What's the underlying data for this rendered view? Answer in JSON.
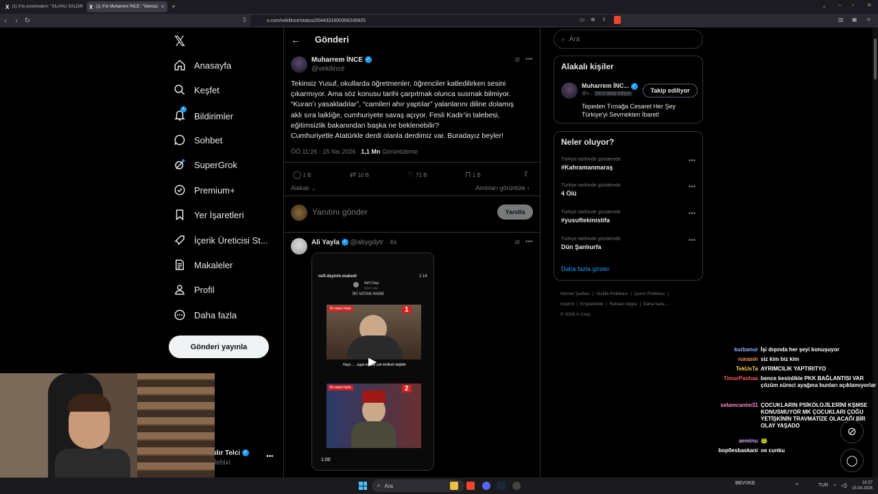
{
  "browser": {
    "tabs": [
      {
        "label": "(1) X'te postmodern: \"SİLAHLI SALDIR",
        "active": false
      },
      {
        "label": "(1) X'te Muharrem İNCE: \"Tekinsiz",
        "active": true
      }
    ],
    "url": "x.com/vekilince/status/2044331600356245825"
  },
  "sidebar": {
    "items": [
      {
        "label": "Anasayfa",
        "icon": "home-icon"
      },
      {
        "label": "Keşfet",
        "icon": "search-icon"
      },
      {
        "label": "Bildirimler",
        "icon": "bell-icon",
        "badge": "1"
      },
      {
        "label": "Sohbet",
        "icon": "chat-icon"
      },
      {
        "label": "SuperGrok",
        "icon": "grok-icon"
      },
      {
        "label": "Premium+",
        "icon": "verified-icon"
      },
      {
        "label": "Yer İşaretleri",
        "icon": "bookmark-icon"
      },
      {
        "label": "İçerik Üreticisi St...",
        "icon": "rocket-icon"
      },
      {
        "label": "Makaleler",
        "icon": "article-icon"
      },
      {
        "label": "Profil",
        "icon": "person-icon"
      },
      {
        "label": "Daha fazla",
        "icon": "more-circle-icon"
      }
    ],
    "post_button": "Gönderi yayınla",
    "account_name": "ılır Telci",
    "account_handle": "lebixi"
  },
  "header": {
    "title": "Gönderi"
  },
  "post": {
    "author": "Muharrem İNCE",
    "handle": "@vekilince",
    "text": [
      "Tekinsiz Yusuf, okullarda öğretmenler, öğrenciler katledilirken sesini",
      "çıkarmıyor. Ama söz konusu tarihi çarpıtmak olunca susmak bilmiyor.",
      "“Kuran’ı yasakladılar”, “camileri ahır yaptılar” yalanlarını diline dolamış",
      "aklı sıra laikliğe, cumhuriyete savaş açıyor. Fesli Kadir’in talebesi,",
      "eğitimsizlik bakanından başka ne beklenebilir?",
      "Cumhuriyetle Atatürkle derdi olanla derdimiz var. Buradayız beyler!"
    ],
    "time": "ÖÖ 11:26 · 15 Nis 2026 ·",
    "views_count": "1,1 Mn",
    "views_label": "Görüntüleme",
    "replies": "1 B",
    "reposts": "10 B",
    "likes": "71 B",
    "bookmarks": "1 B",
    "related_label": "Alakalı",
    "quotes_label": "Alıntıları görüntüle"
  },
  "reply_box": {
    "placeholder": "Yanıtını gönder",
    "button": "Yanıtla"
  },
  "reply": {
    "author": "Ali Yayla",
    "handle": "@abygdytr",
    "time": "· 4s",
    "video": {
      "channel": "nefi.dayinin.mabedi",
      "timer": "1:14",
      "inner_user": "Nef'i Dayı",
      "inner_handle": "@nefi_dayi",
      "headline": "İKİ VATAN HAİNİ",
      "label1": "İki vatan haini",
      "num1": "1",
      "caption": "Haçlı... ...işgal etmesi çok tehlikeli değildir",
      "label2": "İki vatan haini",
      "num2": "2",
      "duration": "1:00"
    }
  },
  "right": {
    "search_placeholder": "Ara",
    "related_title": "Alakalı kişiler",
    "related_person": {
      "name": "Muharrem İNC...",
      "handle": "@v...",
      "follows_you": "Seni takip ediyor",
      "button": "Takip ediliyor",
      "bio": [
        "Tepeden Tırnağa Cesaret Her Şey",
        "Türkiye'yi Sevmekten İbaret!"
      ]
    },
    "trends_title": "Neler oluyor?",
    "trends": [
      {
        "category": "Türkiye tarihinde gündemde",
        "name": "#Kahramanmaraş"
      },
      {
        "category": "Türkiye tarihinde gündemde",
        "name": "4 Ölü"
      },
      {
        "category": "Türkiye tarihinde gündemde",
        "name": "#yusuftekinistifa"
      },
      {
        "category": "Türkiye tarihinde gündemde",
        "name": "Dün Şanlıurfa"
      }
    ],
    "show_more": "Daha fazla göster",
    "footer": [
      "Hizmet Şartları",
      "|",
      "Gizlilik Politikası",
      "|",
      "Çerez Politikası",
      "|",
      "Imprint",
      "|",
      "Erişilebilirlik",
      "|",
      "Reklam bilgisi",
      "|",
      "Daha fazla ...",
      "© 2026 X Corp."
    ]
  },
  "chat": [
    {
      "user": "kurbanur",
      "color": "#8fb3ff",
      "msg": "İşi dışında her şeyi konuşuyor"
    },
    {
      "user": "runasin",
      "color": "#ff9d5c",
      "msg": "siz kim biz kim"
    },
    {
      "user": "TekUsTa",
      "color": "#ffd24a",
      "msg": "AYRIMCILIK YAPTIRITYO"
    },
    {
      "user": "TimurPashaa",
      "color": "#ff5a5a",
      "msg": "bence kesinlikle PKK BAĞLANTISI VAR çözüm süreci ayağına bunları açıklamıyorlar"
    },
    {
      "user": "selamcanim31",
      "color": "#ff8fd0",
      "msg": "ÇOCUKLARIN PSİKOLOJİLERİNİ KŞMSE KONUSMUYOR MK ÇOCUKLARI ÇOĞU YETİŞKİNİN TRAVMATİZE OLACAĞI BİR OLAY YAŞADO"
    },
    {
      "user": "aeminu",
      "color": "#c9a7ff",
      "msg": "🐸"
    },
    {
      "user": "bop0esbaskani",
      "color": "#ffffff",
      "msg": "oe cunku"
    }
  ],
  "taskbar": {
    "search": "Ara",
    "lang": "TUR",
    "time": "16:37",
    "date": "15.04.2026",
    "tray_text": "BEVVKE"
  },
  "colors": {
    "accent": "#1d9bf0",
    "background": "#000000",
    "border": "#2f3336",
    "muted": "#71767b"
  }
}
